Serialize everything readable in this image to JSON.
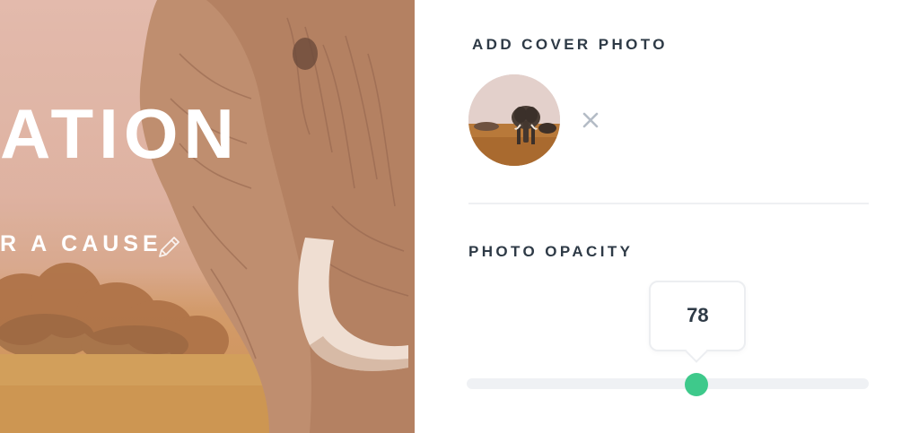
{
  "hero": {
    "title": "ATION",
    "subtitle": "R A CAUSE",
    "edit_icon": "pencil-icon"
  },
  "cover_photo": {
    "label": "ADD COVER PHOTO",
    "thumbnail": "elephant-thumbnail",
    "remove_icon": "close-icon"
  },
  "opacity": {
    "label": "PHOTO OPACITY",
    "value": 78,
    "value_text": "78",
    "max": 100
  },
  "colors": {
    "accent": "#3ec98b",
    "heading_text": "#2e3a46",
    "track": "#eff1f4",
    "icon_gray": "#b4bcc6"
  }
}
